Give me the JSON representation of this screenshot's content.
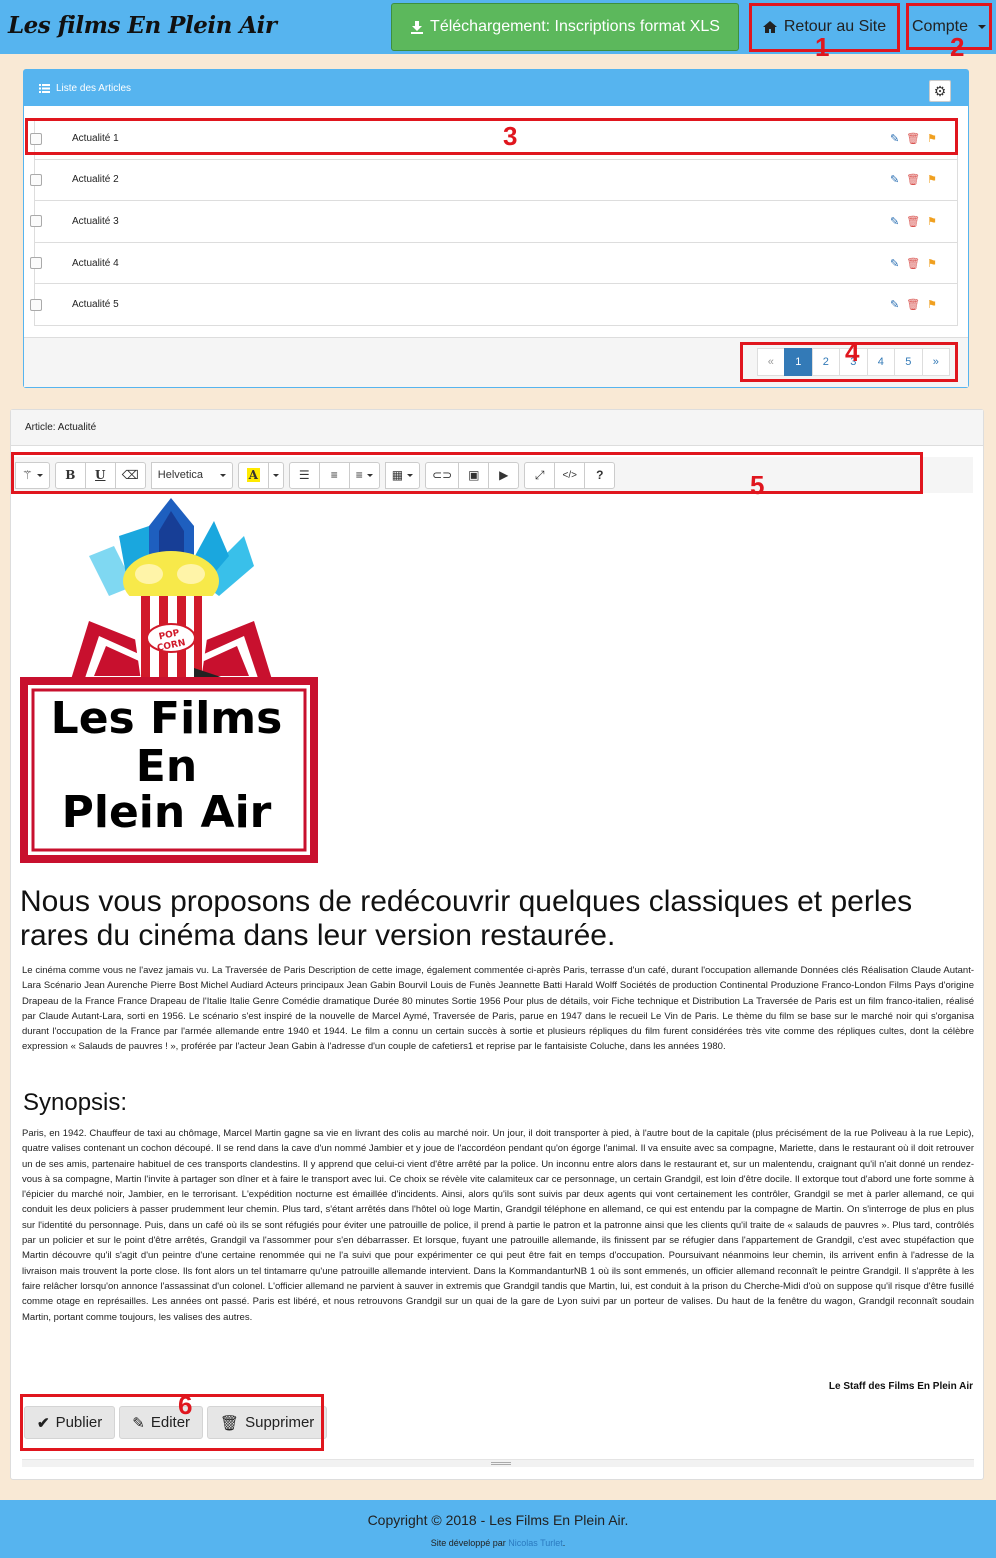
{
  "navbar": {
    "brand": "Les films En Plein Air",
    "download_label": "Téléchargement: Inscriptions format XLS",
    "home_label": "Retour au Site",
    "account_label": "Compte"
  },
  "annotations": [
    "1",
    "2",
    "3",
    "4",
    "5",
    "6"
  ],
  "articles_panel": {
    "title": "Liste des Articles",
    "items": [
      {
        "title": "Actualité 1"
      },
      {
        "title": "Actualité 2"
      },
      {
        "title": "Actualité 3"
      },
      {
        "title": "Actualité 4"
      },
      {
        "title": "Actualité 5"
      }
    ],
    "pagination": [
      "«",
      "1",
      "2",
      "3",
      "4",
      "5",
      "»"
    ],
    "current_page": "1"
  },
  "article": {
    "heading": "Article: Actualité",
    "toolbar": {
      "font_name": "Helvetica"
    },
    "logo": {
      "line1": "Les Films",
      "line2": "En",
      "line3": "Plein Air",
      "badge_line1": "POP",
      "badge_line2": "CORN"
    },
    "lead": "Nous vous proposons de redécouvrir quelques classiques et perles rares du cinéma dans leur version restaurée.",
    "paragraph1": "Le cinéma comme vous ne l'avez jamais vu. La Traversée de Paris Description de cette image, également commentée ci-après Paris, terrasse d'un café, durant l'occupation allemande Données clés Réalisation Claude Autant-Lara Scénario Jean Aurenche Pierre Bost Michel Audiard Acteurs principaux Jean Gabin Bourvil Louis de Funès Jeannette Batti Harald Wolff Sociétés de production Continental Produzione Franco-London Films Pays d'origine Drapeau de la France France Drapeau de l'Italie Italie Genre Comédie dramatique Durée 80 minutes Sortie 1956 Pour plus de détails, voir Fiche technique et Distribution La Traversée de Paris est un film franco-italien, réalisé par Claude Autant-Lara, sorti en 1956. Le scénario s'est inspiré de la nouvelle de Marcel Aymé, Traversée de Paris, parue en 1947 dans le recueil Le Vin de Paris. Le thème du film se base sur le marché noir qui s'organisa durant l'occupation de la France par l'armée allemande entre 1940 et 1944. Le film a connu un certain succès à sortie et plusieurs répliques du film furent considérées très vite comme des répliques cultes, dont la célèbre expression « Salauds de pauvres ! », proférée par l'acteur Jean Gabin à l'adresse d'un couple de cafetiers1 et reprise par le fantaisiste Coluche, dans les années 1980.",
    "synopsis_title": "Synopsis:",
    "synopsis": "Paris, en 1942. Chauffeur de taxi au chômage, Marcel Martin gagne sa vie en livrant des colis au marché noir. Un jour, il doit transporter à pied, à l'autre bout de la capitale (plus précisément de la rue Poliveau à la rue Lepic), quatre valises contenant un cochon découpé. Il se rend dans la cave d'un nommé Jambier et y joue de l'accordéon pendant qu'on égorge l'animal. Il va ensuite avec sa compagne, Mariette, dans le restaurant où il doit retrouver un de ses amis, partenaire habituel de ces transports clandestins. Il y apprend que celui-ci vient d'être arrêté par la police. Un inconnu entre alors dans le restaurant et, sur un malentendu, craignant qu'il n'ait donné un rendez-vous à sa compagne, Martin l'invite à partager son dîner et à faire le transport avec lui. Ce choix se révèle vite calamiteux car ce personnage, un certain Grandgil, est loin d'être docile. Il extorque tout d'abord une forte somme à l'épicier du marché noir, Jambier, en le terrorisant. L'expédition nocturne est émaillée d'incidents. Ainsi, alors qu'ils sont suivis par deux agents qui vont certainement les contrôler, Grandgil se met à parler allemand, ce qui conduit les deux policiers à passer prudemment leur chemin. Plus tard, s'étant arrêtés dans l'hôtel où loge Martin, Grandgil téléphone en allemand, ce qui est entendu par la compagne de Martin. On s'interroge de plus en plus sur l'identité du personnage. Puis, dans un café où ils se sont réfugiés pour éviter une patrouille de police, il prend à partie le patron et la patronne ainsi que les clients qu'il traite de « salauds de pauvres ». Plus tard, contrôlés par un policier et sur le point d'être arrêtés, Grandgil va l'assommer pour s'en débarrasser. Et lorsque, fuyant une patrouille allemande, ils finissent par se réfugier dans l'appartement de Grandgil, c'est avec stupéfaction que Martin découvre qu'il s'agit d'un peintre d'une certaine renommée qui ne l'a suivi que pour expérimenter ce qui peut être fait en temps d'occupation. Poursuivant néanmoins leur chemin, ils arrivent enfin à l'adresse de la livraison mais trouvent la porte close. Ils font alors un tel tintamarre qu'une patrouille allemande intervient. Dans la KommandanturNB 1 où ils sont emmenés, un officier allemand reconnaît le peintre Grandgil. Il s'apprête à les faire relâcher lorsqu'on annonce l'assassinat d'un colonel. L'officier allemand ne parvient à sauver in extremis que Grandgil tandis que Martin, lui, est conduit à la prison du Cherche-Midi d'où on suppose qu'il risque d'être fusillé comme otage en représailles. Les années ont passé. Paris est libéré, et nous retrouvons Grandgil sur un quai de la gare de Lyon suivi par un porteur de valises. Du haut de la fenêtre du wagon, Grandgil reconnaît soudain Martin, portant comme toujours, les valises des autres.",
    "signature": "Le Staff des Films En Plein Air",
    "actions": {
      "publish": "Publier",
      "edit": "Editer",
      "delete": "Supprimer"
    }
  },
  "footer": {
    "copyright": "Copyright © 2018 - Les Films En Plein Air.",
    "dev_prefix": "Site développé par",
    "dev_name": "Nicolas Turlet",
    "dev_suffix": "."
  },
  "colors": {
    "navbar": "#56b4ef",
    "background": "#f9e9d5",
    "success": "#5cb85c",
    "annotation": "#e0161e",
    "primary": "#337ab7"
  }
}
